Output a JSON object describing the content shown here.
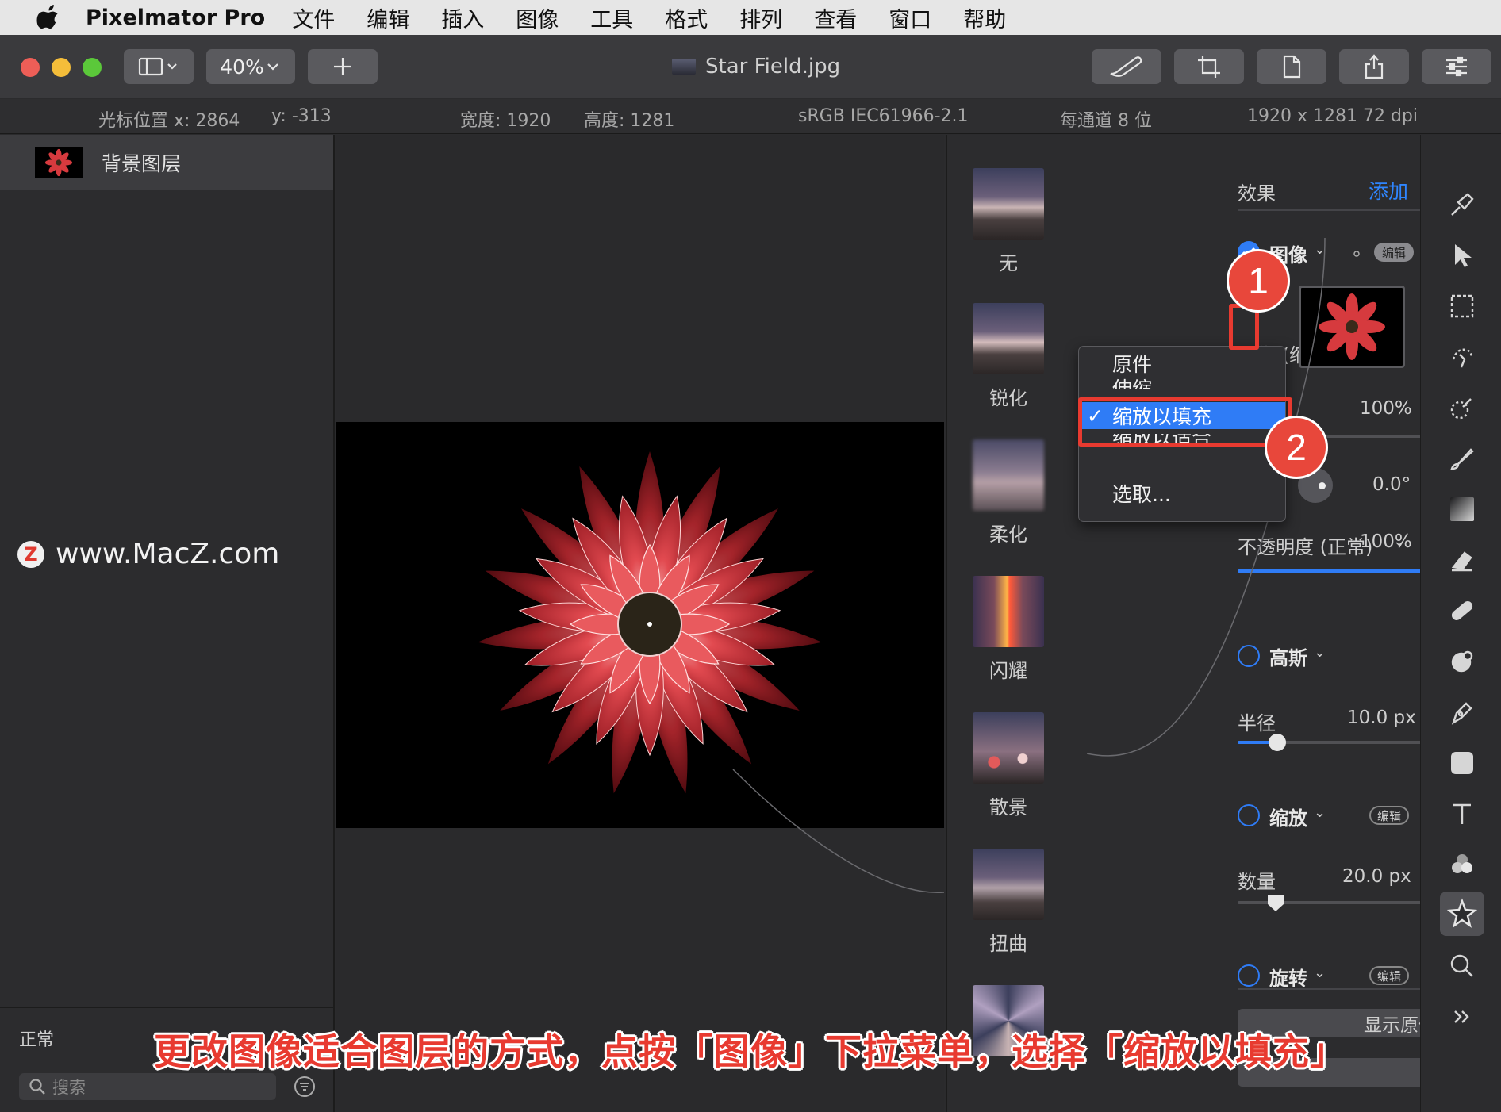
{
  "menubar": {
    "app_name": "Pixelmator Pro",
    "items": [
      "文件",
      "编辑",
      "插入",
      "图像",
      "工具",
      "格式",
      "排列",
      "查看",
      "窗口",
      "帮助"
    ]
  },
  "toolbar": {
    "zoom": "40%",
    "document_title": "Star Field.jpg"
  },
  "infobar": {
    "cursor_x": "光标位置 x:  2864",
    "cursor_y": "y:  -313",
    "width": "宽度:  1920",
    "height": "高度:  1281",
    "color_profile": "sRGB IEC61966-2.1",
    "bit_depth": "每通道 8 位",
    "dimensions": "1920 x 1281 72 dpi"
  },
  "layers": {
    "layer_name": "背景图层",
    "blend_mode": "正常",
    "search_placeholder": "搜索"
  },
  "watermark": "www.MacZ.com",
  "presets": [
    "无",
    "锐化",
    "柔化",
    "闪耀",
    "散景",
    "扭曲"
  ],
  "effects": {
    "header": "效果",
    "add": "添加",
    "image_title": "图像",
    "edit_badge": "编辑",
    "image_fit_label": "图像 (缩放以填充",
    "percent_value": "100%",
    "angle_value": "0.0°",
    "opacity_label": "不透明度 (正常)",
    "opacity_value": "100%",
    "gaussian_title": "高斯",
    "radius_label": "半径",
    "radius_value": "10.0 px",
    "zoom_title": "缩放",
    "amount_label": "数量",
    "amount_value": "20.0 px",
    "rotate_title": "旋转",
    "show_original": "显示原件"
  },
  "dropdown": {
    "items": [
      "原件",
      "伸缩",
      "缩放以填充",
      "缩放以适合",
      "选取..."
    ],
    "selected": "缩放以填充"
  },
  "annotations": {
    "step1": "1",
    "step2": "2",
    "caption": "更改图像适合图层的方式，点按「图像」下拉菜单，选择「缩放以填充」"
  },
  "colors": {
    "accent": "#2f7cf6",
    "annotation_red": "#e83a30"
  }
}
